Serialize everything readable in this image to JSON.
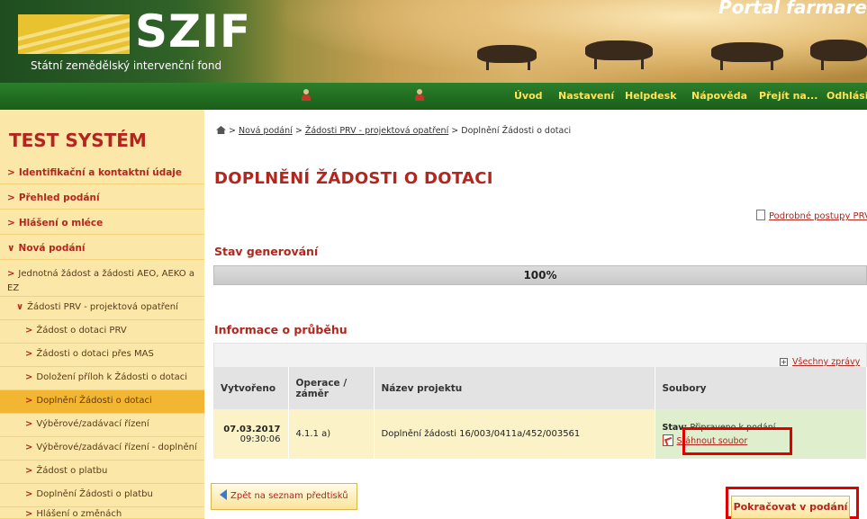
{
  "header": {
    "logo_text": "SZIF",
    "logo_subtitle": "Státní zemědělský intervenční fond",
    "portal_title": "Portal farmare"
  },
  "nav": {
    "items": [
      "Úvod",
      "Nastavení",
      "Helpdesk",
      "Nápověda",
      "Přejít na...",
      "Odhlási"
    ]
  },
  "sidebar": {
    "title": "TEST SYSTÉM",
    "sections": [
      "Identifikační a kontaktní údaje",
      "Přehled podání",
      "Hlášení o mléce",
      "Nová podání"
    ],
    "sub_items": [
      "Jednotná žádost a žádosti AEO, AEKO a EZ",
      "Žádosti PRV - projektová opatření"
    ],
    "sub_sub_items": [
      "Žádost o dotaci PRV",
      "Žádosti o dotaci přes MAS",
      "Doložení příloh k Žádosti o dotaci",
      "Doplnění Žádosti o dotaci",
      "Výběrové/zadávací řízení",
      "Výběrové/zadávací řízení - doplnění",
      "Žádost o platbu",
      "Doplnění Žádosti o platbu",
      "Hlášení o změnách"
    ]
  },
  "breadcrumb": {
    "items": [
      "Nová podání",
      "Žádosti PRV - projektová opatření",
      "Doplnění Žádosti o dotaci"
    ],
    "sep": ">"
  },
  "main": {
    "title": "DOPLNĚNÍ ŽÁDOSTI O DOTACI",
    "detail_link": "Podrobné postupy PRV",
    "gen_title": "Stav generování",
    "progress_text": "100%",
    "progress_value": 1.0,
    "info_title": "Informace o průběhu",
    "all_messages": "Všechny zprávy"
  },
  "table": {
    "headers": [
      "Vytvořeno",
      "Operace / záměr",
      "Název projektu",
      "Soubory"
    ],
    "row": {
      "date": "07.03.2017",
      "time": "09:30:06",
      "operation": "4.1.1 a)",
      "project": "Doplnění žádosti 16/003/0411a/452/003561",
      "status_label": "Stav:",
      "status_value": "Připraveno k podání",
      "download": "Stáhnout soubor"
    }
  },
  "buttons": {
    "back": "Zpět na seznam předtisků",
    "continue": "Pokračovat v podání"
  },
  "colors": {
    "accent": "#b3261e",
    "nav_green": "#1a5e1a",
    "sidebar_bg": "#fbe7a8",
    "sidebar_active": "#f3b632",
    "highlight_frame": "#e00000"
  }
}
